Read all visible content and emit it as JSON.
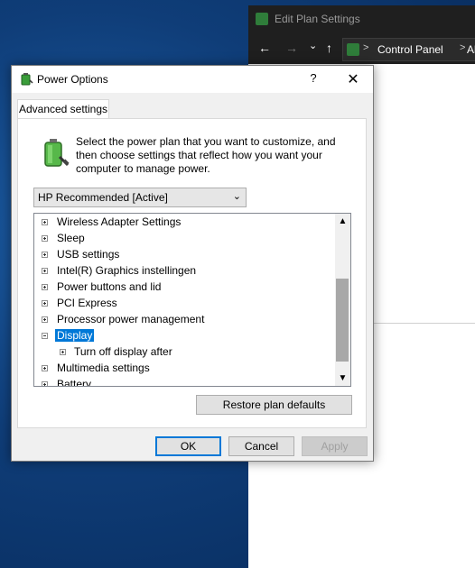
{
  "background_window": {
    "title": "Edit Plan Settings",
    "nav": {
      "back": "←",
      "forward": "→",
      "dropdown": "⌄",
      "up": "↑"
    },
    "address": {
      "sep": ">",
      "segment1": "Control Panel",
      "segment2": "Al"
    }
  },
  "dialog": {
    "title": "Power Options",
    "help": "?",
    "close": "✕",
    "tab": "Advanced settings",
    "intro": "Select the power plan that you want to customize, and then choose settings that reflect how you want your computer to manage power.",
    "plan": "HP Recommended [Active]",
    "tree": [
      {
        "label": "Wireless Adapter Settings"
      },
      {
        "label": "Sleep"
      },
      {
        "label": "USB settings"
      },
      {
        "label": "Intel(R) Graphics instellingen"
      },
      {
        "label": "Power buttons and lid"
      },
      {
        "label": "PCI Express"
      },
      {
        "label": "Processor power management"
      },
      {
        "label": "Display"
      },
      {
        "label": "Turn off display after"
      },
      {
        "label": "Multimedia settings"
      },
      {
        "label": "Battery"
      }
    ],
    "restore_button": "Restore plan defaults",
    "ok": "OK",
    "cancel": "Cancel",
    "apply": "Apply"
  },
  "colors": {
    "selection": "#0078d7",
    "desktop": "#0f3d78"
  }
}
